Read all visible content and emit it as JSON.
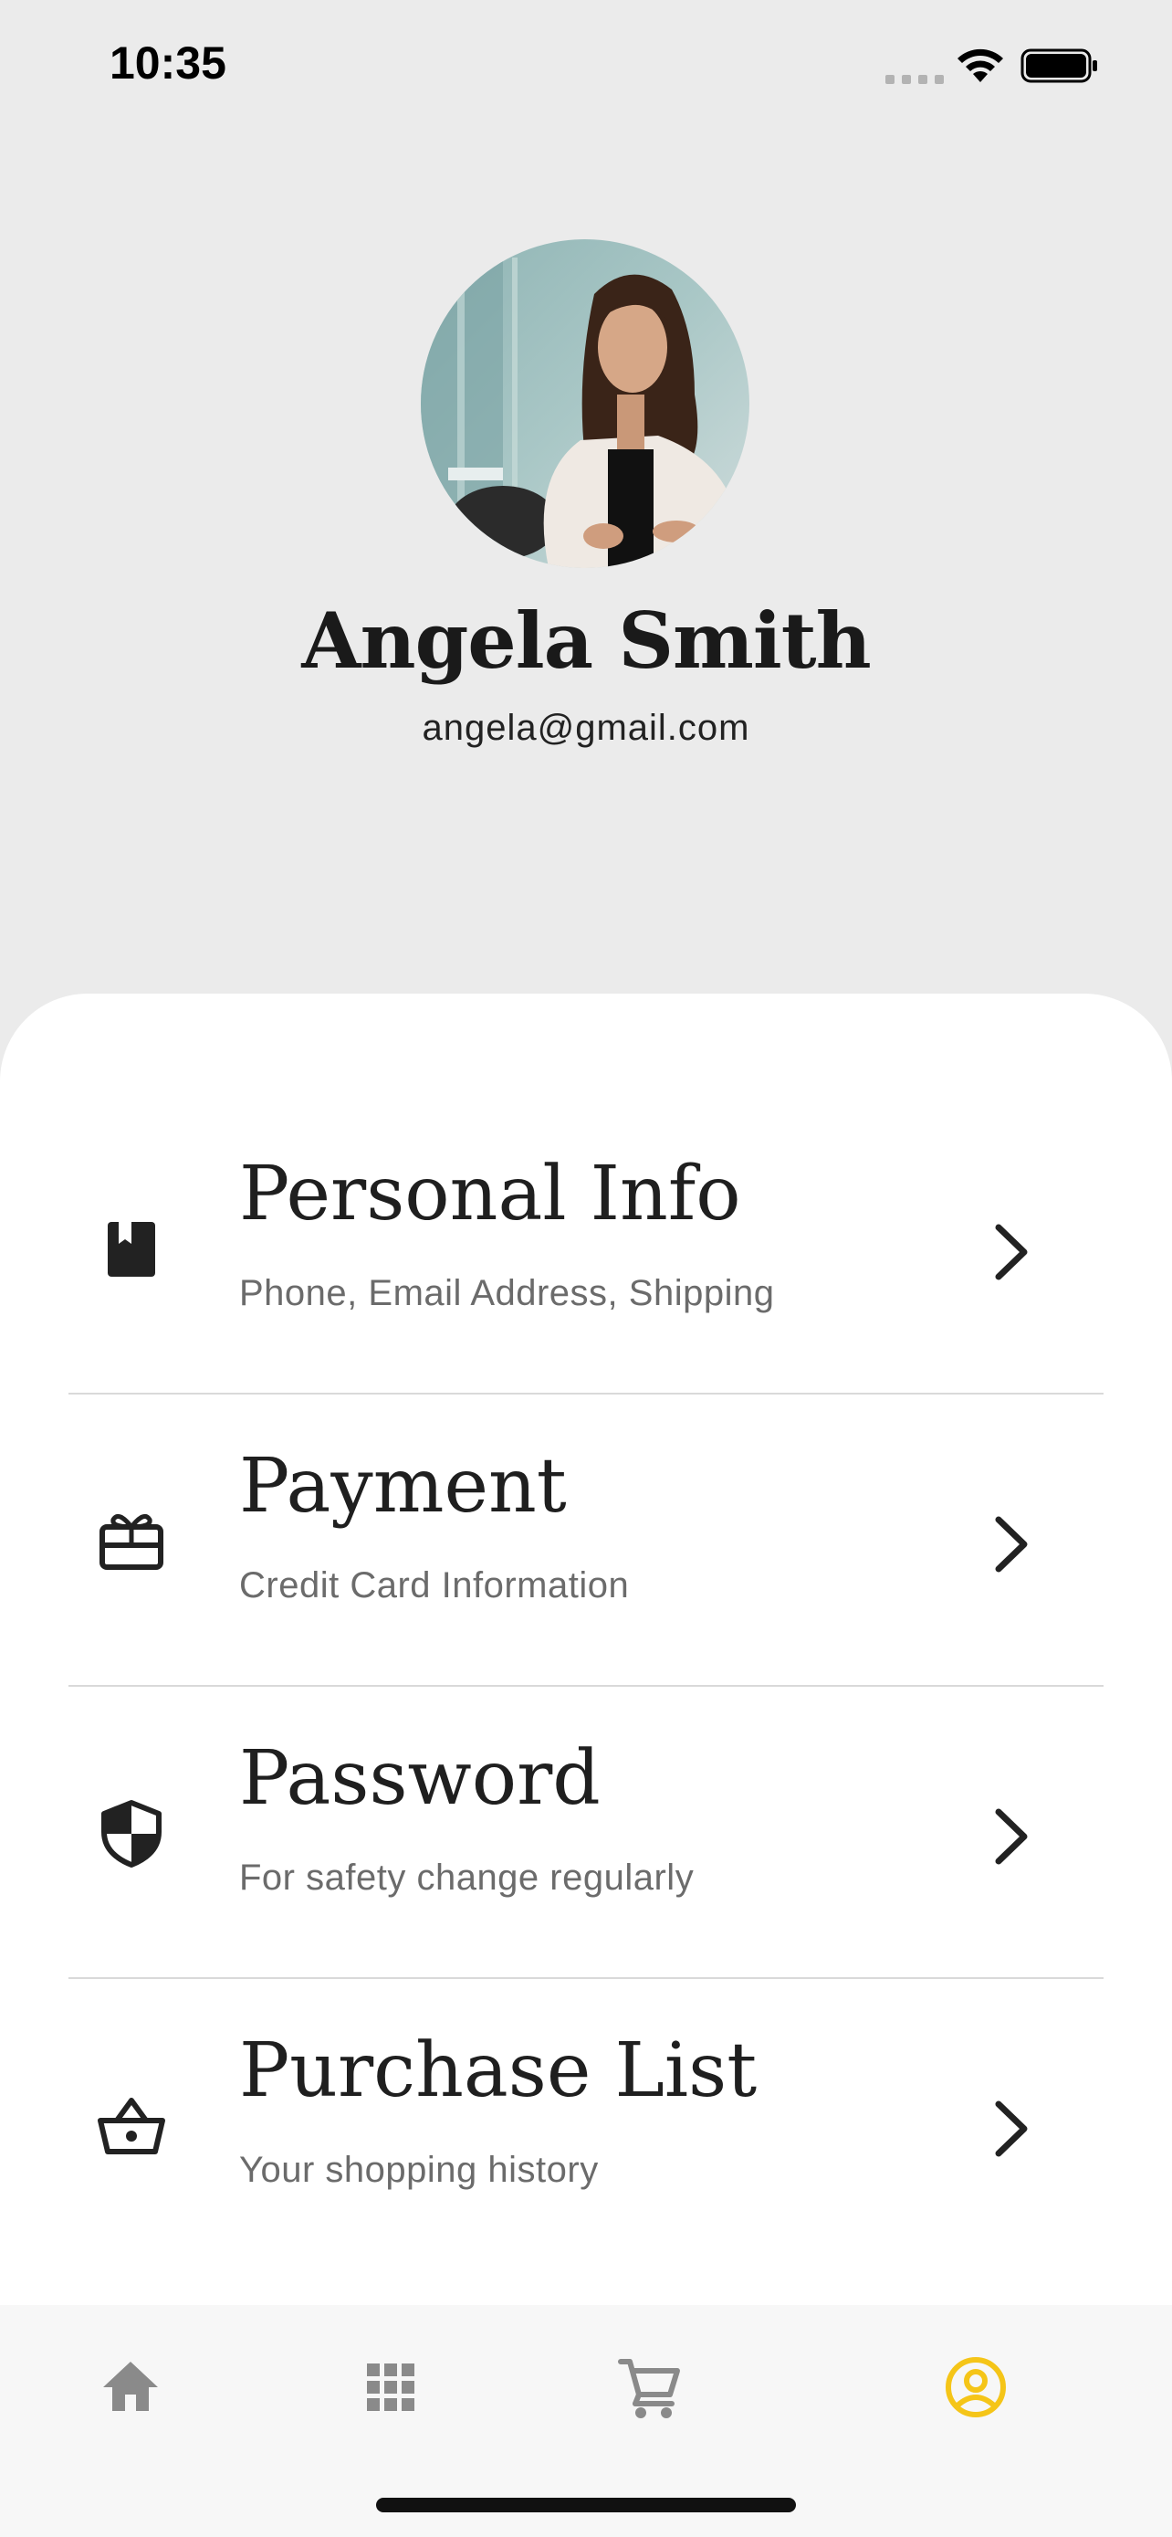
{
  "status_bar": {
    "time": "10:35"
  },
  "profile": {
    "name": "Angela Smith",
    "email": "angela@gmail.com",
    "avatar": "profile-photo"
  },
  "menu": [
    {
      "title": "Personal Info",
      "subtitle": "Phone, Email Address, Shipping",
      "icon": "contact-book-icon"
    },
    {
      "title": "Payment",
      "subtitle": "Credit Card Information",
      "icon": "credit-card-gift-icon"
    },
    {
      "title": "Password",
      "subtitle": "For safety change regularly",
      "icon": "shield-icon"
    },
    {
      "title": "Purchase List",
      "subtitle": "Your shopping history",
      "icon": "shopping-basket-icon"
    }
  ],
  "bottom_nav": {
    "items": [
      {
        "icon": "home-icon",
        "active": false
      },
      {
        "icon": "grid-icon",
        "active": false
      },
      {
        "icon": "cart-icon",
        "active": false
      },
      {
        "icon": "account-circle-icon",
        "active": true
      }
    ]
  },
  "colors": {
    "accent": "#f5c518",
    "background": "#ebebeb",
    "card": "#ffffff",
    "nav_inactive": "#8a8a8a"
  }
}
